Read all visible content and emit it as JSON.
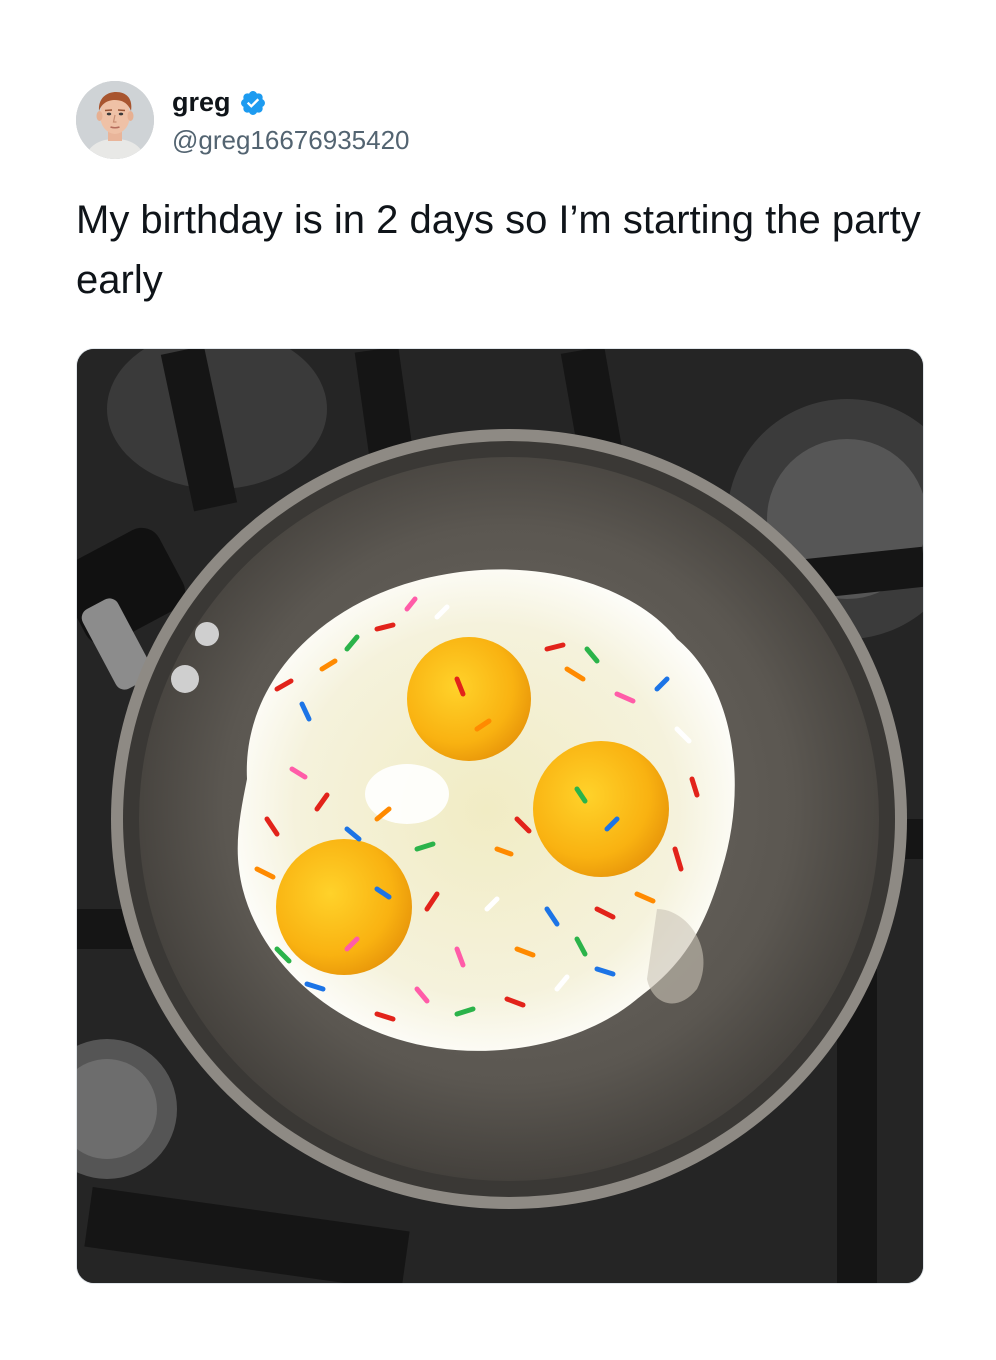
{
  "tweet": {
    "author": {
      "display_name": "greg",
      "handle": "@greg16676935420",
      "verified": true,
      "avatar_icon": "profile-photo",
      "verified_icon": "verified-badge-icon"
    },
    "text": "My birthday is in 2 days so I’m starting the party early",
    "media": {
      "type": "photo",
      "icon": "photo-of-fried-eggs-with-sprinkles"
    }
  },
  "colors": {
    "text_primary": "#0f1419",
    "text_secondary": "#536471",
    "verified_blue": "#1d9bf0"
  }
}
